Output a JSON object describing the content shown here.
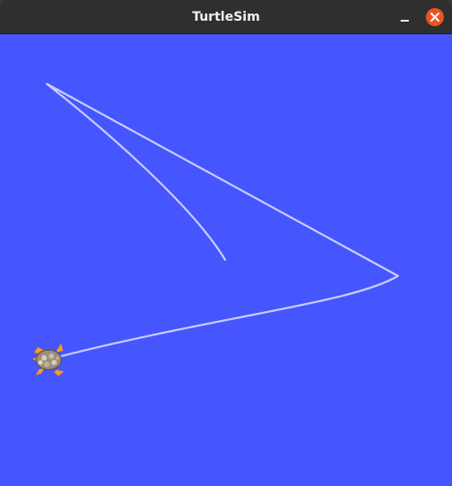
{
  "window": {
    "title": "TurtleSim"
  },
  "controls": {
    "minimize_icon": "minimize-icon",
    "close_icon": "close-icon"
  },
  "colors": {
    "canvas_background": "#4556ff",
    "title_bar": "#2f2f2f",
    "trail": "#c8ccff",
    "close_button": "#e95420"
  }
}
